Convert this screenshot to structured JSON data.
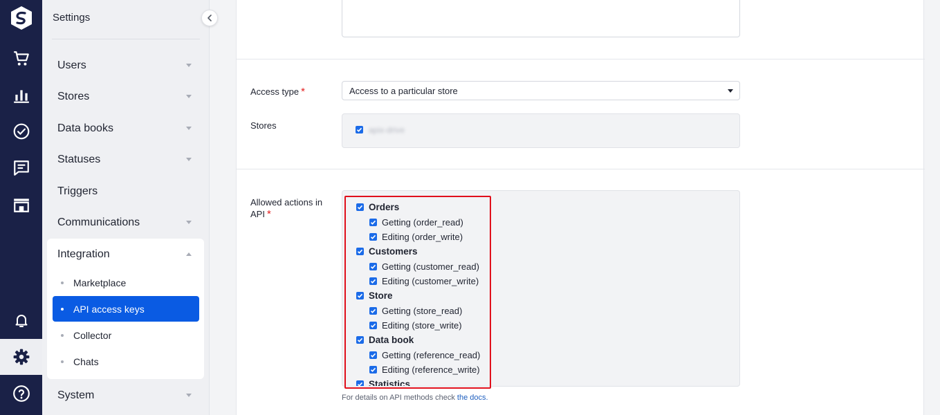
{
  "rail": {
    "icons": [
      "logo-icon",
      "cart-icon",
      "analytics-icon",
      "tasks-icon",
      "chats-icon",
      "store-icon",
      "bell-icon",
      "gear-icon",
      "help-icon"
    ]
  },
  "settings_panel": {
    "title": "Settings",
    "menu": [
      {
        "label": "Users"
      },
      {
        "label": "Stores"
      },
      {
        "label": "Data books"
      },
      {
        "label": "Statuses"
      },
      {
        "label": "Triggers"
      },
      {
        "label": "Communications"
      },
      {
        "label": "Integration"
      },
      {
        "label": "System"
      }
    ],
    "integration_sub": [
      {
        "label": "Marketplace"
      },
      {
        "label": "API access keys"
      },
      {
        "label": "Collector"
      },
      {
        "label": "Chats"
      }
    ]
  },
  "form": {
    "access_type_label": "Access type",
    "access_type_value": "Access to a particular store",
    "stores_label": "Stores",
    "store_blurred": "apix-drive",
    "allowed_label_line1": "Allowed actions in",
    "allowed_label_line2": "API",
    "required_mark": "*",
    "groups": [
      {
        "name": "Orders",
        "items": [
          "Getting (order_read)",
          "Editing (order_write)"
        ]
      },
      {
        "name": "Customers",
        "items": [
          "Getting (customer_read)",
          "Editing (customer_write)"
        ]
      },
      {
        "name": "Store",
        "items": [
          "Getting (store_read)",
          "Editing (store_write)"
        ]
      },
      {
        "name": "Data book",
        "items": [
          "Getting (reference_read)",
          "Editing (reference_write)"
        ]
      },
      {
        "name": "Statistics",
        "items": []
      }
    ],
    "hint_prefix": "For details on API methods check ",
    "hint_link": "the docs."
  },
  "colors": {
    "rail": "#1a2147",
    "accent": "#0a5be3",
    "checkbox": "#1b6be8",
    "highlight": "#e00f1b",
    "required": "#e31c1c"
  }
}
